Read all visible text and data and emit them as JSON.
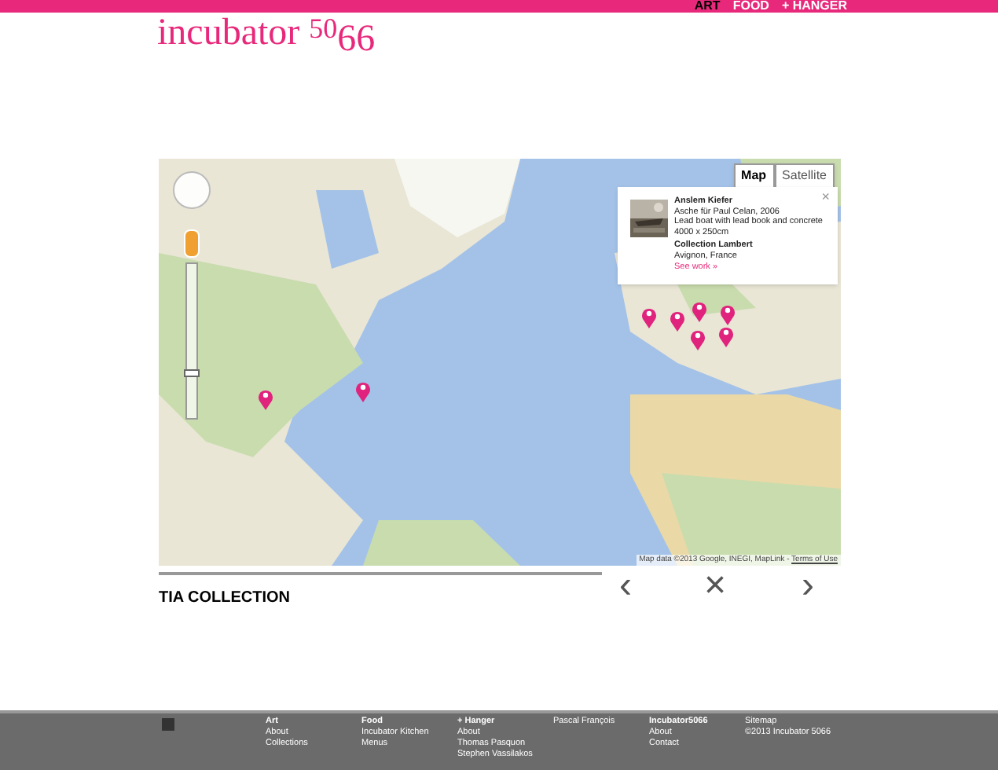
{
  "top_nav": [
    {
      "label": "ART",
      "selected": true
    },
    {
      "label": "FOOD",
      "selected": false
    },
    {
      "label": "+ HANGER",
      "selected": false
    }
  ],
  "logo": {
    "word": "incubator",
    "num_high": "50",
    "num_low": "66"
  },
  "map": {
    "zoom_slider": {
      "level": 0.3
    },
    "type_buttons": [
      {
        "label": "Map",
        "selected": true
      },
      {
        "label": "Satellite",
        "selected": false
      }
    ],
    "popup": {
      "artist": "Anslem Kiefer",
      "title": "Asche für Paul Celan, 2006",
      "medium": "Lead boat with lead book and concrete",
      "size": "4000 x 250cm",
      "collection": "Collection Lambert",
      "place": "Avignon, France",
      "link": "See work »",
      "close": "×"
    },
    "attribution": "Map data ©2013 Google, INEGI, MapLink - ",
    "terms": "Terms of Use"
  },
  "section": {
    "title": "TIA COLLECTION",
    "prev": "‹",
    "close": "×",
    "next": "›"
  },
  "footer": {
    "columns": [
      {
        "title": "Art",
        "links": [
          "About",
          "Collections"
        ]
      },
      {
        "title": "Food",
        "links": [
          "Incubator Kitchen",
          "Menus"
        ]
      },
      {
        "title": "+ Hanger",
        "links": [
          "About",
          "Thomas Pasquon",
          "Stephen Vassilakos"
        ]
      },
      {
        "links": [
          "Pascal François"
        ]
      },
      {
        "title": "Incubator5066",
        "links": [
          "About",
          "Contact"
        ]
      },
      {
        "links": [
          "Sitemap",
          "©2013 Incubator 5066"
        ]
      }
    ]
  }
}
